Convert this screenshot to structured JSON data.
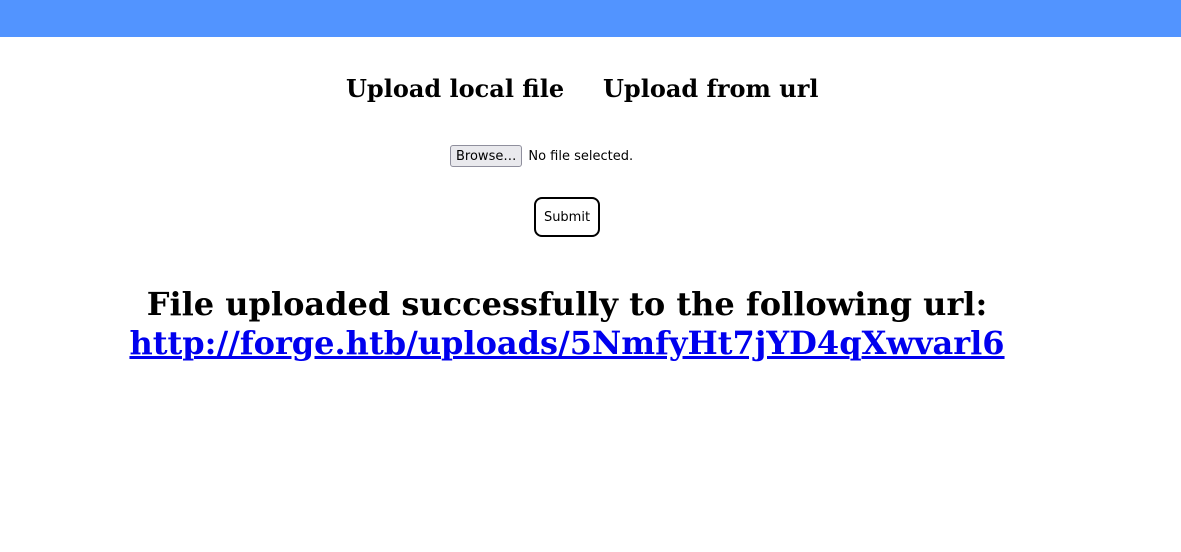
{
  "colors": {
    "topbar": "#5294ff",
    "link": "#0000ee"
  },
  "tabs": [
    {
      "label": "Upload local file"
    },
    {
      "label": "Upload from url"
    }
  ],
  "file_input": {
    "button_label": "Browse…",
    "status": "No file selected."
  },
  "submit": {
    "label": "Submit"
  },
  "result": {
    "message": "File uploaded successfully to the following url:",
    "url": "http://forge.htb/uploads/5NmfyHt7jYD4qXwvarl6"
  }
}
